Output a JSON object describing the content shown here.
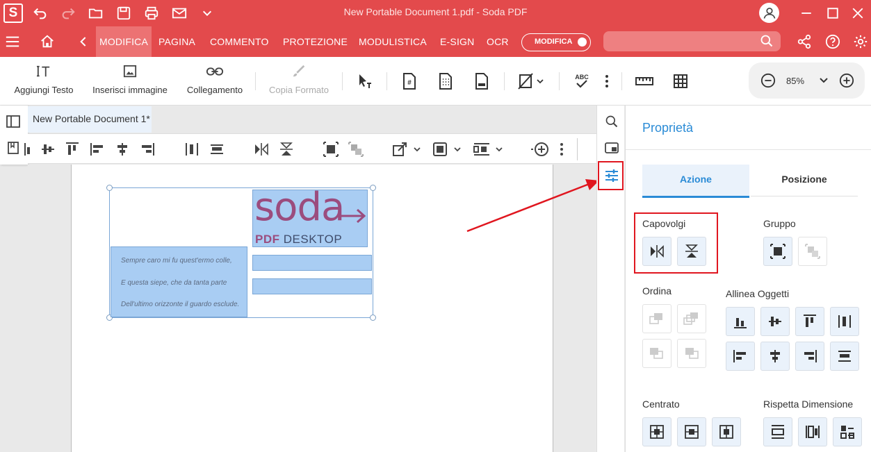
{
  "window": {
    "title": "New Portable Document 1.pdf   -   Soda PDF",
    "app_logo": "S"
  },
  "menu": {
    "items": [
      "MODIFICA",
      "PAGINA",
      "COMMENTO",
      "PROTEZIONE",
      "MODULISTICA",
      "E-SIGN",
      "OCR"
    ],
    "mode_toggle_label": "MODIFICA"
  },
  "toolbar": {
    "add_text": "Aggiungi Testo",
    "insert_image": "Inserisci immagine",
    "link": "Collegamento",
    "format_painter": "Copia Formato",
    "zoom_value": "85%"
  },
  "document": {
    "tab_title": "New Portable Document 1*",
    "logo_word": "soda",
    "logo_sub_bold": "PDF",
    "logo_sub": "DESKTOP",
    "poem_lines": [
      "Sempre caro mi fu quest'ermo colle,",
      "E questa siepe, che da tanta parte",
      "Dell'ultimo orizzonte il guardo esclude."
    ]
  },
  "properties": {
    "title": "Proprietà",
    "tabs": [
      "Azione",
      "Posizione"
    ],
    "sections": {
      "flip": "Capovolgi",
      "group": "Gruppo",
      "order": "Ordina",
      "align": "Allinea Oggetti",
      "center": "Centrato",
      "size": "Rispetta Dimensione"
    }
  },
  "colors": {
    "brand_red": "#e34a4c",
    "accent_blue": "#2a8bd6",
    "annotation_red": "#e0161f",
    "selection_fill": "#a9cdf3"
  }
}
